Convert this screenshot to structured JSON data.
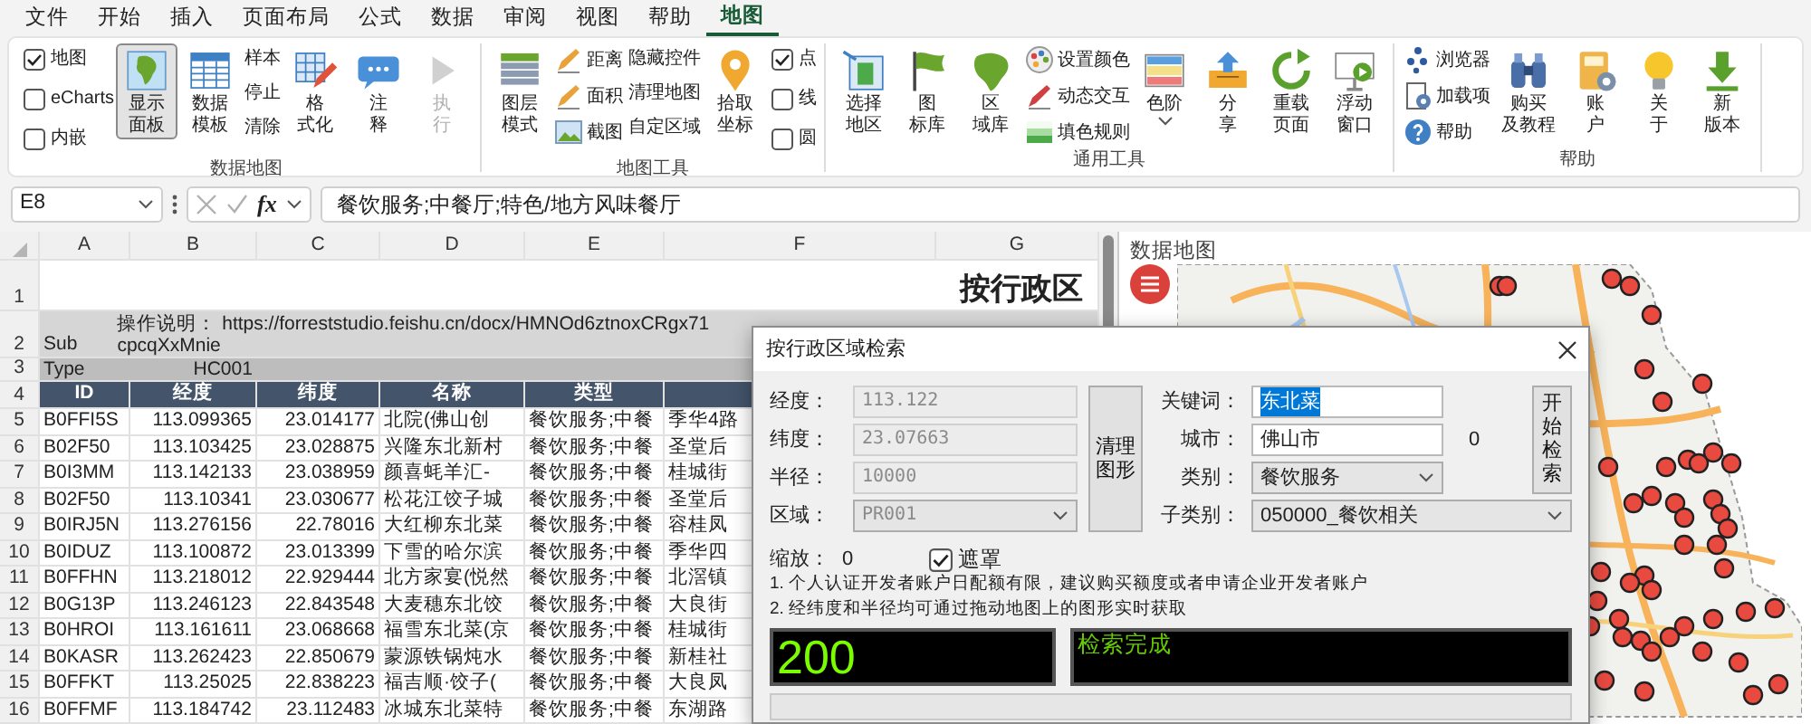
{
  "menu_tabs": [
    {
      "label": "文件",
      "selected": false
    },
    {
      "label": "开始",
      "selected": false
    },
    {
      "label": "插入",
      "selected": false
    },
    {
      "label": "页面布局",
      "selected": false
    },
    {
      "label": "公式",
      "selected": false
    },
    {
      "label": "数据",
      "selected": false
    },
    {
      "label": "审阅",
      "selected": false
    },
    {
      "label": "视图",
      "selected": false
    },
    {
      "label": "帮助",
      "selected": false
    },
    {
      "label": "地图",
      "selected": true
    }
  ],
  "ribbon_groups": [
    {
      "label": "数据地图",
      "items": [
        {
          "kind": "checks",
          "options": [
            {
              "label": "地图",
              "checked": true
            },
            {
              "label": "eCharts",
              "checked": false
            },
            {
              "label": "内嵌",
              "checked": false
            }
          ]
        },
        {
          "kind": "large",
          "label": "显示面板",
          "pressed": true,
          "disabled": false
        },
        {
          "kind": "large",
          "label": "数据模板",
          "pressed": false,
          "disabled": false
        },
        {
          "kind": "text_list",
          "labels": [
            "样本",
            "停止",
            "清除"
          ]
        },
        {
          "kind": "large",
          "label": "格式化",
          "pressed": false,
          "disabled": false
        },
        {
          "kind": "large",
          "label": "注释",
          "pressed": false,
          "disabled": false
        },
        {
          "kind": "large",
          "label": "执行",
          "pressed": false,
          "disabled": true
        }
      ]
    },
    {
      "label": "地图工具",
      "items": [
        {
          "kind": "large",
          "label": "图层模式",
          "pressed": false,
          "disabled": false
        },
        {
          "kind": "icon_list",
          "labels": [
            "距离",
            "面积",
            "截图"
          ]
        },
        {
          "kind": "text_list",
          "labels": [
            "隐藏控件",
            "清理地图",
            "自定区域"
          ]
        },
        {
          "kind": "large",
          "label": "拾取坐标",
          "pressed": false,
          "disabled": false
        },
        {
          "kind": "checks",
          "options": [
            {
              "label": "点",
              "checked": true
            },
            {
              "label": "线",
              "checked": false
            },
            {
              "label": "圆",
              "checked": false
            }
          ]
        }
      ]
    },
    {
      "label": "通用工具",
      "items": [
        {
          "kind": "large",
          "label": "选择地区",
          "pressed": false,
          "disabled": false
        },
        {
          "kind": "large",
          "label": "图标库",
          "pressed": false,
          "disabled": false
        },
        {
          "kind": "large",
          "label": "区域库",
          "pressed": false,
          "disabled": false
        },
        {
          "kind": "icon_list",
          "labels": [
            "设置颜色",
            "动态交互",
            "填色规则"
          ]
        },
        {
          "kind": "menu",
          "label": "色阶",
          "pressed": false,
          "disabled": false
        },
        {
          "kind": "large",
          "label": "分享",
          "pressed": false,
          "disabled": false
        },
        {
          "kind": "large",
          "label": "重载页面",
          "pressed": false,
          "disabled": false
        },
        {
          "kind": "large",
          "label": "浮动窗口",
          "pressed": false,
          "disabled": false
        }
      ]
    },
    {
      "label": "帮助",
      "items": [
        {
          "kind": "icon_list",
          "labels": [
            "浏览器",
            "加载项",
            "帮助"
          ]
        },
        {
          "kind": "large",
          "label": "购买及教程",
          "pressed": false,
          "disabled": false
        },
        {
          "kind": "large",
          "label": "账户",
          "pressed": false,
          "disabled": false
        },
        {
          "kind": "large",
          "label": "关于",
          "pressed": false,
          "disabled": false
        },
        {
          "kind": "large",
          "label": "新版本",
          "pressed": false,
          "disabled": false
        }
      ]
    }
  ],
  "formula_bar": {
    "name_box": "E8",
    "function_label": "fx",
    "formula": "餐饮服务;中餐厅;特色/地方风味餐厅"
  },
  "sheet": {
    "columns": [
      "A",
      "B",
      "C",
      "D",
      "E",
      "F",
      "G"
    ],
    "title": {
      "row": "1",
      "text": "按行政区"
    },
    "sub": {
      "row": "2",
      "label": "Sub",
      "instructions": "操作说明： https://forreststudio.feishu.cn/docx/HMNOd6ztnoxCRgx71cpcqXxMnie"
    },
    "type": {
      "row": "3",
      "label": "Type",
      "value": "HC001"
    },
    "header": {
      "row": "4",
      "cells": [
        "ID",
        "经度",
        "纬度",
        "名称",
        "类型"
      ]
    },
    "rows": [
      {
        "row": "5",
        "cells": [
          "B0FFI5S",
          "113.099365",
          "23.014177",
          "北院(佛山创",
          "餐饮服务;中餐",
          "季华4路"
        ]
      },
      {
        "row": "6",
        "cells": [
          "B02F50",
          "113.103425",
          "23.028875",
          "兴隆东北新村",
          "餐饮服务;中餐",
          "圣堂后"
        ]
      },
      {
        "row": "7",
        "cells": [
          "B0I3MM",
          "113.142133",
          "23.038959",
          "颜喜蚝羊汇-",
          "餐饮服务;中餐",
          "桂城街"
        ]
      },
      {
        "row": "8",
        "cells": [
          "B02F50",
          "113.10341",
          "23.030677",
          "松花江饺子城",
          "餐饮服务;中餐",
          "圣堂后"
        ]
      },
      {
        "row": "9",
        "cells": [
          "B0IRJ5N",
          "113.276156",
          "22.78016",
          "大红柳东北菜",
          "餐饮服务;中餐",
          "容桂凤"
        ]
      },
      {
        "row": "10",
        "cells": [
          "B0IDUZ",
          "113.100872",
          "23.013399",
          "下雪的哈尔滨",
          "餐饮服务;中餐",
          "季华四"
        ]
      },
      {
        "row": "11",
        "cells": [
          "B0FFHN",
          "113.218012",
          "22.929444",
          "北方家宴(悦然",
          "餐饮服务;中餐",
          "北滘镇"
        ]
      },
      {
        "row": "12",
        "cells": [
          "B0G13P",
          "113.246123",
          "22.843548",
          "大麦穗东北饺",
          "餐饮服务;中餐",
          "大良街"
        ]
      },
      {
        "row": "13",
        "cells": [
          "B0HROI",
          "113.161611",
          "23.068668",
          "福雪东北菜(京",
          "餐饮服务;中餐",
          "桂城街"
        ]
      },
      {
        "row": "14",
        "cells": [
          "B0KASR",
          "113.262423",
          "22.850679",
          "蒙源铁锅炖水",
          "餐饮服务;中餐",
          "新桂社"
        ]
      },
      {
        "row": "15",
        "cells": [
          "B0FFKT",
          "113.25025",
          "22.838223",
          "福吉顺·饺子(",
          "餐饮服务;中餐",
          "大良凤"
        ]
      },
      {
        "row": "16",
        "cells": [
          "B0FFMF",
          "113.184742",
          "23.112483",
          "冰城东北菜特",
          "餐饮服务;中餐",
          "东湖路"
        ]
      }
    ]
  },
  "map_panel": {
    "title": "数据地图"
  },
  "dialog": {
    "title": "按行政区域检索",
    "coord_fields": [
      {
        "label": "经度：",
        "value": "113.122",
        "kind": "text",
        "disabled": true
      },
      {
        "label": "纬度：",
        "value": "23.07663",
        "kind": "text",
        "disabled": true
      },
      {
        "label": "半径：",
        "value": "10000",
        "kind": "text",
        "disabled": true
      },
      {
        "label": "区域：",
        "value": "PR001",
        "kind": "select",
        "disabled": true
      }
    ],
    "clear_button": "清理图形",
    "search_fields": [
      {
        "label": "关键词：",
        "value": "东北菜",
        "kind": "text",
        "text_selected": true
      },
      {
        "label": "城市：",
        "value": "佛山市",
        "kind": "text",
        "text_selected": false,
        "note": "0"
      },
      {
        "label": "类别：",
        "value": "餐饮服务",
        "kind": "select",
        "text_selected": false
      },
      {
        "label": "子类别：",
        "value": "050000_餐饮相关",
        "kind": "select",
        "text_selected": false
      }
    ],
    "search_button": "开始检索",
    "zoom_label": "缩放：",
    "zoom_value": "0",
    "mask": {
      "label": "遮罩",
      "checked": true
    },
    "notes": [
      "1. 个人认证开发者账户日配额有限，建议购买额度或者申请企业开发者账户",
      "2. 经纬度和半径均可通过拖动地图上的图形实时获取"
    ],
    "count_display": "200",
    "status_display": "检索完成",
    "progress": {
      "level": 0
    }
  }
}
